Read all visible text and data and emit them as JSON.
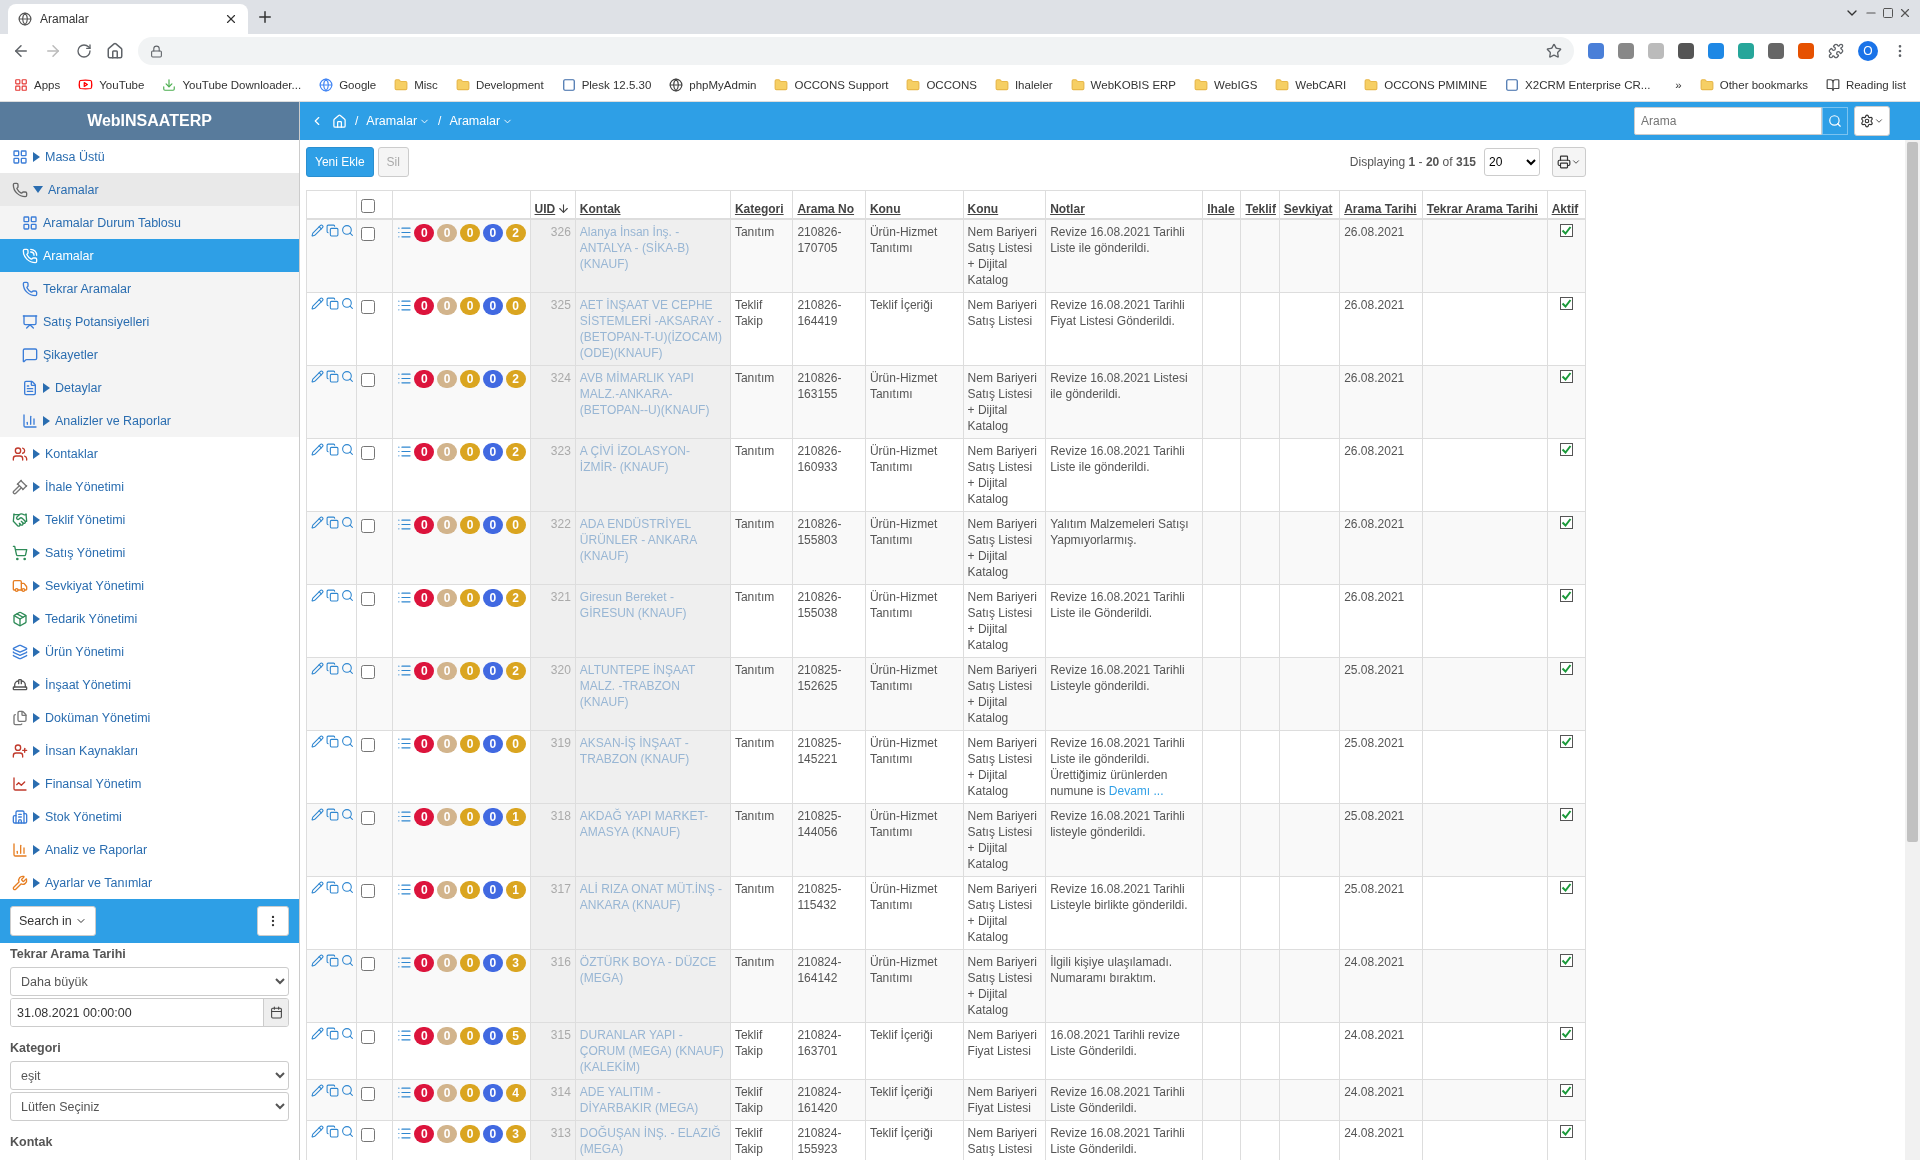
{
  "browser": {
    "tab": {
      "title": "Aramalar"
    },
    "profile_initial": "O",
    "bookmarks": [
      {
        "label": "Apps",
        "kind": "apps"
      },
      {
        "label": "YouTube",
        "kind": "video"
      },
      {
        "label": "YouTube Downloader...",
        "kind": "download"
      },
      {
        "label": "Google",
        "kind": "google"
      },
      {
        "label": "Misc",
        "kind": "folder"
      },
      {
        "label": "Development",
        "kind": "folder"
      },
      {
        "label": "Plesk 12.5.30",
        "kind": "site"
      },
      {
        "label": "phpMyAdmin",
        "kind": "globe"
      },
      {
        "label": "OCCONS Support",
        "kind": "folder"
      },
      {
        "label": "OCCONS",
        "kind": "folder"
      },
      {
        "label": "Ihaleler",
        "kind": "folder"
      },
      {
        "label": "WebKOBIS ERP",
        "kind": "folder"
      },
      {
        "label": "WebIGS",
        "kind": "folder"
      },
      {
        "label": "WebCARI",
        "kind": "folder"
      },
      {
        "label": "OCCONS PMIMINE",
        "kind": "folder"
      },
      {
        "label": "X2CRM Enterprise CR...",
        "kind": "site"
      }
    ],
    "more_bookmarks": "»",
    "other_bookmarks": "Other bookmarks",
    "reading_list": "Reading list"
  },
  "app": {
    "brand": "WebINSAATERP",
    "breadcrumb": {
      "separator": "/",
      "items": [
        "Aramalar",
        "Aramalar"
      ]
    },
    "search": {
      "placeholder": "Arama"
    }
  },
  "sidebar": {
    "items": [
      {
        "label": "Masa Üstü",
        "expanded": false,
        "selected": false
      },
      {
        "label": "Aramalar",
        "expanded": true,
        "selected": false,
        "children": [
          {
            "label": "Aramalar Durum Tablosu",
            "selected": false
          },
          {
            "label": "Aramalar",
            "selected": true
          },
          {
            "label": "Tekrar Aramalar",
            "selected": false
          },
          {
            "label": "Satış Potansiyelleri",
            "selected": false
          },
          {
            "label": "Şikayetler",
            "selected": false
          },
          {
            "label": "Detaylar",
            "expanded": false,
            "selected": false
          },
          {
            "label": "Analizler ve Raporlar",
            "expanded": false,
            "selected": false
          }
        ]
      },
      {
        "label": "Kontaklar",
        "expanded": false,
        "selected": false
      },
      {
        "label": "İhale Yönetimi",
        "expanded": false,
        "selected": false
      },
      {
        "label": "Teklif Yönetimi",
        "expanded": false,
        "selected": false
      },
      {
        "label": "Satış Yönetimi",
        "expanded": false,
        "selected": false
      },
      {
        "label": "Sevkiyat Yönetimi",
        "expanded": false,
        "selected": false
      },
      {
        "label": "Tedarik Yönetimi",
        "expanded": false,
        "selected": false
      },
      {
        "label": "Ürün Yönetimi",
        "expanded": false,
        "selected": false
      },
      {
        "label": "İnşaat Yönetimi",
        "expanded": false,
        "selected": false
      },
      {
        "label": "Doküman Yönetimi",
        "expanded": false,
        "selected": false
      },
      {
        "label": "İnsan Kaynakları",
        "expanded": false,
        "selected": false
      },
      {
        "label": "Finansal Yönetim",
        "expanded": false,
        "selected": false
      },
      {
        "label": "Stok Yönetimi",
        "expanded": false,
        "selected": false
      },
      {
        "label": "Analiz ve Raporlar",
        "expanded": false,
        "selected": false
      },
      {
        "label": "Ayarlar ve Tanımlar",
        "expanded": false,
        "selected": false
      }
    ],
    "search_in": "Search in",
    "filters": [
      {
        "label": "Tekrar Arama Tarihi",
        "operator": "Daha büyük",
        "value": "31.08.2021 00:00:00"
      },
      {
        "label": "Kategori",
        "operator": "eşit",
        "choice": "Lütfen Seçiniz"
      },
      {
        "label": "Kontak"
      }
    ]
  },
  "toolbar": {
    "add": "Yeni Ekle",
    "delete": "Sil",
    "paging": "Displaying **1** - **20** of **315**",
    "page_size": "20"
  },
  "table": {
    "select_all_checked": false,
    "columns": [
      {
        "label": "UID",
        "sorted_descending": true
      },
      {
        "label": "Kontak"
      },
      {
        "label": "Kategori"
      },
      {
        "label": "Arama No"
      },
      {
        "label": "Konu"
      },
      {
        "label": "Konu"
      },
      {
        "label": "Notlar"
      },
      {
        "label": "Ihale"
      },
      {
        "label": "Teklif"
      },
      {
        "label": "Sevkiyat"
      },
      {
        "label": "Arama Tarihi"
      },
      {
        "label": "Tekrar Arama Tarihi"
      },
      {
        "label": "Aktif"
      }
    ],
    "rows": [
      {
        "checked": false,
        "badges": [
          {
            "value": "0",
            "color": "#dc143c"
          },
          {
            "value": "0",
            "color": "#d2b48c"
          },
          {
            "value": "0",
            "color": "#daa520"
          },
          {
            "value": "0",
            "color": "#4169e1"
          },
          {
            "value": "2",
            "color": "#daa520"
          }
        ],
        "uid": "326",
        "kontak": "Alanya İnsan İnş. - ANTALYA - (SİKA-B) (KNAUF)",
        "kategori": "Tanıtım",
        "arama_no": "210826-170705",
        "konu": "Ürün-Hizmet Tanıtımı",
        "konu_2": "Nem Bariyeri Satış Listesi + Dijital Katalog",
        "notlar": "Revize 16.08.2021 Tarihli Liste ile gönderildi.",
        "arama_tarihi": "26.08.2021",
        "aktif": true
      },
      {
        "checked": false,
        "badges": [
          {
            "value": "0",
            "color": "#dc143c"
          },
          {
            "value": "0",
            "color": "#d2b48c"
          },
          {
            "value": "0",
            "color": "#daa520"
          },
          {
            "value": "0",
            "color": "#4169e1"
          },
          {
            "value": "0",
            "color": "#daa520"
          }
        ],
        "uid": "325",
        "kontak": "AET İNŞAAT VE CEPHE SİSTEMLERİ -AKSARAY - (BETOPAN-T-U)(İZOCAM) (ODE)(KNAUF)",
        "kategori": "Teklif Takip",
        "arama_no": "210826-164419",
        "konu": "Teklif İçeriği",
        "konu_2": "Nem Bariyeri Satış Listesi",
        "notlar": "Revize 16.08.2021 Tarihli Fiyat Listesi Gönderildi.",
        "arama_tarihi": "26.08.2021",
        "aktif": true
      },
      {
        "checked": false,
        "badges": [
          {
            "value": "0",
            "color": "#dc143c"
          },
          {
            "value": "0",
            "color": "#d2b48c"
          },
          {
            "value": "0",
            "color": "#daa520"
          },
          {
            "value": "0",
            "color": "#4169e1"
          },
          {
            "value": "2",
            "color": "#daa520"
          }
        ],
        "uid": "324",
        "kontak": "AVB MİMARLIK YAPI MALZ.-ANKARA- (BETOPAN--U)(KNAUF)",
        "kategori": "Tanıtım",
        "arama_no": "210826-163155",
        "konu": "Ürün-Hizmet Tanıtımı",
        "konu_2": "Nem Bariyeri Satış Listesi + Dijital Katalog",
        "notlar": "Revize 16.08.2021 Listesi ile gönderildi.",
        "arama_tarihi": "26.08.2021",
        "aktif": true
      },
      {
        "checked": false,
        "badges": [
          {
            "value": "0",
            "color": "#dc143c"
          },
          {
            "value": "0",
            "color": "#d2b48c"
          },
          {
            "value": "0",
            "color": "#daa520"
          },
          {
            "value": "0",
            "color": "#4169e1"
          },
          {
            "value": "2",
            "color": "#daa520"
          }
        ],
        "uid": "323",
        "kontak": "A ÇİVİ İZOLASYON- İZMİR- (KNAUF)",
        "kategori": "Tanıtım",
        "arama_no": "210826-160933",
        "konu": "Ürün-Hizmet Tanıtımı",
        "konu_2": "Nem Bariyeri Satış Listesi + Dijital Katalog",
        "notlar": "Revize 16.08.2021 Tarihli Liste ile gönderildi.",
        "arama_tarihi": "26.08.2021",
        "aktif": true
      },
      {
        "checked": false,
        "badges": [
          {
            "value": "0",
            "color": "#dc143c"
          },
          {
            "value": "0",
            "color": "#d2b48c"
          },
          {
            "value": "0",
            "color": "#daa520"
          },
          {
            "value": "0",
            "color": "#4169e1"
          },
          {
            "value": "0",
            "color": "#daa520"
          }
        ],
        "uid": "322",
        "kontak": "ADA ENDÜSTRİYEL ÜRÜNLER - ANKARA (KNAUF)",
        "kategori": "Tanıtım",
        "arama_no": "210826-155803",
        "konu": "Ürün-Hizmet Tanıtımı",
        "konu_2": "Nem Bariyeri Satış Listesi + Dijital Katalog",
        "notlar": "Yalıtım Malzemeleri Satışı Yapmıyorlarmış.",
        "arama_tarihi": "26.08.2021",
        "aktif": true
      },
      {
        "checked": false,
        "badges": [
          {
            "value": "0",
            "color": "#dc143c"
          },
          {
            "value": "0",
            "color": "#d2b48c"
          },
          {
            "value": "0",
            "color": "#daa520"
          },
          {
            "value": "0",
            "color": "#4169e1"
          },
          {
            "value": "2",
            "color": "#daa520"
          }
        ],
        "uid": "321",
        "kontak": "Giresun Bereket - GİRESUN (KNAUF)",
        "kategori": "Tanıtım",
        "arama_no": "210826-155038",
        "konu": "Ürün-Hizmet Tanıtımı",
        "konu_2": "Nem Bariyeri Satış Listesi + Dijital Katalog",
        "notlar": "Revize 16.08.2021 Tarihli Liste ile Gönderildi.",
        "arama_tarihi": "26.08.2021",
        "aktif": true
      },
      {
        "checked": false,
        "badges": [
          {
            "value": "0",
            "color": "#dc143c"
          },
          {
            "value": "0",
            "color": "#d2b48c"
          },
          {
            "value": "0",
            "color": "#daa520"
          },
          {
            "value": "0",
            "color": "#4169e1"
          },
          {
            "value": "2",
            "color": "#daa520"
          }
        ],
        "uid": "320",
        "kontak": "ALTUNTEPE İNŞAAT MALZ. -TRABZON (KNAUF)",
        "kategori": "Tanıtım",
        "arama_no": "210825-152625",
        "konu": "Ürün-Hizmet Tanıtımı",
        "konu_2": "Nem Bariyeri Satış Listesi + Dijital Katalog",
        "notlar": "Revize 16.08.2021 Tarihli Listeyle gönderildi.",
        "arama_tarihi": "25.08.2021",
        "aktif": true
      },
      {
        "checked": false,
        "badges": [
          {
            "value": "0",
            "color": "#dc143c"
          },
          {
            "value": "0",
            "color": "#d2b48c"
          },
          {
            "value": "0",
            "color": "#daa520"
          },
          {
            "value": "0",
            "color": "#4169e1"
          },
          {
            "value": "0",
            "color": "#daa520"
          }
        ],
        "uid": "319",
        "kontak": "AKSAN-İŞ İNŞAAT - TRABZON (KNAUF)",
        "kategori": "Tanıtım",
        "arama_no": "210825-145221",
        "konu": "Ürün-Hizmet Tanıtımı",
        "konu_2": "Nem Bariyeri Satış Listesi + Dijital Katalog",
        "notlar": "Revize 16.08.2021 Tarihli Liste ile gönderildi. Ürettiğimiz ürünlerden numune is",
        "notlar_more": "Devamı ...",
        "arama_tarihi": "25.08.2021",
        "aktif": true
      },
      {
        "checked": false,
        "badges": [
          {
            "value": "0",
            "color": "#dc143c"
          },
          {
            "value": "0",
            "color": "#d2b48c"
          },
          {
            "value": "0",
            "color": "#daa520"
          },
          {
            "value": "0",
            "color": "#4169e1"
          },
          {
            "value": "1",
            "color": "#daa520"
          }
        ],
        "uid": "318",
        "kontak": "AKDAĞ YAPI MARKET- AMASYA (KNAUF)",
        "kategori": "Tanıtım",
        "arama_no": "210825-144056",
        "konu": "Ürün-Hizmet Tanıtımı",
        "konu_2": "Nem Bariyeri Satış Listesi + Dijital Katalog",
        "notlar": "Revize 16.08.2021 Tarihli listeyle gönderildi.",
        "arama_tarihi": "25.08.2021",
        "aktif": true
      },
      {
        "checked": false,
        "badges": [
          {
            "value": "0",
            "color": "#dc143c"
          },
          {
            "value": "0",
            "color": "#d2b48c"
          },
          {
            "value": "0",
            "color": "#daa520"
          },
          {
            "value": "0",
            "color": "#4169e1"
          },
          {
            "value": "1",
            "color": "#daa520"
          }
        ],
        "uid": "317",
        "kontak": "ALİ RIZA ONAT MÜT.İNŞ - ANKARA (KNAUF)",
        "kategori": "Tanıtım",
        "arama_no": "210825-115432",
        "konu": "Ürün-Hizmet Tanıtımı",
        "konu_2": "Nem Bariyeri Satış Listesi + Dijital Katalog",
        "notlar": "Revize 16.08.2021 Tarihli Listeyle birlikte gönderildi.",
        "arama_tarihi": "25.08.2021",
        "aktif": true
      },
      {
        "checked": false,
        "badges": [
          {
            "value": "0",
            "color": "#dc143c"
          },
          {
            "value": "0",
            "color": "#d2b48c"
          },
          {
            "value": "0",
            "color": "#daa520"
          },
          {
            "value": "0",
            "color": "#4169e1"
          },
          {
            "value": "3",
            "color": "#daa520"
          }
        ],
        "uid": "316",
        "kontak": "ÖZTÜRK BOYA - DÜZCE (MEGA)",
        "kategori": "Tanıtım",
        "arama_no": "210824-164142",
        "konu": "Ürün-Hizmet Tanıtımı",
        "konu_2": "Nem Bariyeri Satış Listesi + Dijital Katalog",
        "notlar": "İlgili kişiye ulaşılamadı. Numaramı bıraktım.",
        "arama_tarihi": "24.08.2021",
        "aktif": true
      },
      {
        "checked": false,
        "badges": [
          {
            "value": "0",
            "color": "#dc143c"
          },
          {
            "value": "0",
            "color": "#d2b48c"
          },
          {
            "value": "0",
            "color": "#daa520"
          },
          {
            "value": "0",
            "color": "#4169e1"
          },
          {
            "value": "5",
            "color": "#daa520"
          }
        ],
        "uid": "315",
        "kontak": "DURANLAR YAPI - ÇORUM (MEGA) (KNAUF) (KALEKİM)",
        "kategori": "Teklif Takip",
        "arama_no": "210824-163701",
        "konu": "Teklif İçeriği",
        "konu_2": "Nem Bariyeri Fiyat Listesi",
        "notlar": "16.08.2021 Tarihli revize Liste Gönderildi.",
        "arama_tarihi": "24.08.2021",
        "aktif": true
      },
      {
        "checked": false,
        "badges": [
          {
            "value": "0",
            "color": "#dc143c"
          },
          {
            "value": "0",
            "color": "#d2b48c"
          },
          {
            "value": "0",
            "color": "#daa520"
          },
          {
            "value": "0",
            "color": "#4169e1"
          },
          {
            "value": "4",
            "color": "#daa520"
          }
        ],
        "uid": "314",
        "kontak": "ADE YALITIM - DİYARBAKIR (MEGA)",
        "kategori": "Teklif Takip",
        "arama_no": "210824-161420",
        "konu": "Teklif İçeriği",
        "konu_2": "Nem Bariyeri Fiyat Listesi",
        "notlar": "Revize 16.08.2021 Tarihli Liste Gönderildi.",
        "arama_tarihi": "24.08.2021",
        "aktif": true
      },
      {
        "checked": false,
        "badges": [
          {
            "value": "0",
            "color": "#dc143c"
          },
          {
            "value": "0",
            "color": "#d2b48c"
          },
          {
            "value": "0",
            "color": "#daa520"
          },
          {
            "value": "0",
            "color": "#4169e1"
          },
          {
            "value": "3",
            "color": "#daa520"
          }
        ],
        "uid": "313",
        "kontak": "DOĞUŞAN İNŞ. - ELAZIĞ (MEGA)",
        "kategori": "Teklif Takip",
        "arama_no": "210824-155923",
        "konu": "Teklif İçeriği",
        "konu_2": "Nem Bariyeri Satış Listesi",
        "notlar": "Revize 16.08.2021 Tarihli Liste Gönderildi.",
        "arama_tarihi": "24.08.2021",
        "aktif": true
      }
    ]
  }
}
